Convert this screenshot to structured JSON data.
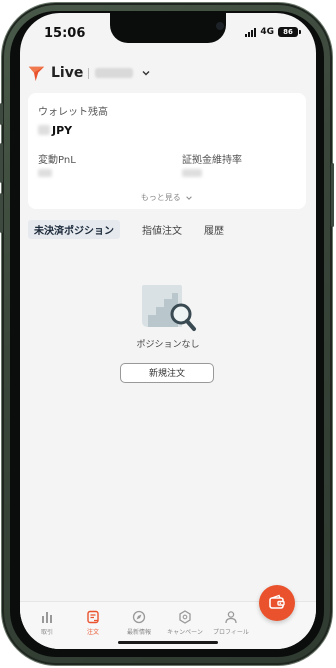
{
  "status_bar": {
    "time": "15:06",
    "network": "4G",
    "battery": "86"
  },
  "header": {
    "environment": "Live",
    "logo_color": "#e9522c"
  },
  "wallet_card": {
    "balance_label": "ウォレット残高",
    "balance_currency": "JPY",
    "pnl_label": "変動PnL",
    "margin_label": "証拠金維持率",
    "more_label": "もっと見る"
  },
  "tabs": [
    {
      "label": "未決済ポジション",
      "active": true
    },
    {
      "label": "指値注文",
      "active": false
    },
    {
      "label": "履歴",
      "active": false
    }
  ],
  "empty_state": {
    "message": "ポジションなし",
    "button_label": "新規注文"
  },
  "bottom_nav": [
    {
      "label": "取引",
      "icon": "chart-bars-icon",
      "active": false
    },
    {
      "label": "注文",
      "icon": "order-doc-icon",
      "active": true
    },
    {
      "label": "最新情報",
      "icon": "compass-icon",
      "active": false
    },
    {
      "label": "キャンペーン",
      "icon": "badge-icon",
      "active": false
    },
    {
      "label": "プロフィール",
      "icon": "person-icon",
      "active": false
    }
  ],
  "accent_color": "#e9522c"
}
